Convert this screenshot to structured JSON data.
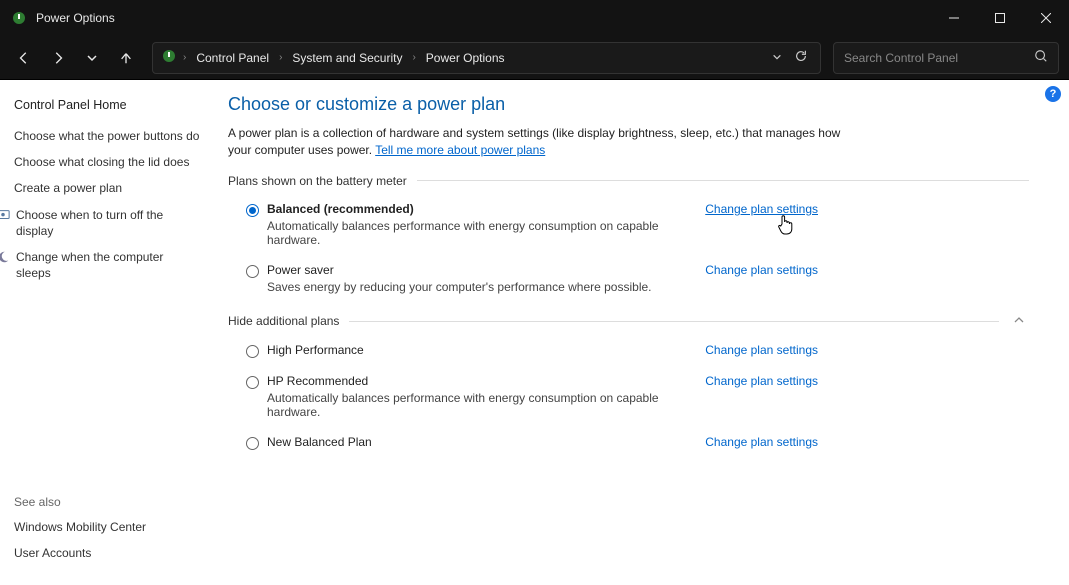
{
  "window": {
    "title": "Power Options"
  },
  "breadcrumb": {
    "items": [
      "Control Panel",
      "System and Security",
      "Power Options"
    ]
  },
  "search": {
    "placeholder": "Search Control Panel"
  },
  "sidebar": {
    "home": "Control Panel Home",
    "links": [
      "Choose what the power buttons do",
      "Choose what closing the lid does",
      "Create a power plan",
      "Choose when to turn off the display",
      "Change when the computer sleeps"
    ],
    "see_also_heading": "See also",
    "see_also": [
      "Windows Mobility Center",
      "User Accounts"
    ]
  },
  "main": {
    "title": "Choose or customize a power plan",
    "description": "A power plan is a collection of hardware and system settings (like display brightness, sleep, etc.) that manages how your computer uses power. ",
    "learn_more": "Tell me more about power plans",
    "section_battery": "Plans shown on the battery meter",
    "section_hidden": "Hide additional plans",
    "change_label": "Change plan settings",
    "plans_battery": [
      {
        "name": "Balanced (recommended)",
        "desc": "Automatically balances performance with energy consumption on capable hardware.",
        "selected": true
      },
      {
        "name": "Power saver",
        "desc": "Saves energy by reducing your computer's performance where possible.",
        "selected": false
      }
    ],
    "plans_hidden": [
      {
        "name": "High Performance",
        "desc": "",
        "selected": false
      },
      {
        "name": "HP Recommended",
        "desc": "Automatically balances performance with energy consumption on capable hardware.",
        "selected": false
      },
      {
        "name": "New Balanced Plan",
        "desc": "",
        "selected": false
      }
    ]
  }
}
